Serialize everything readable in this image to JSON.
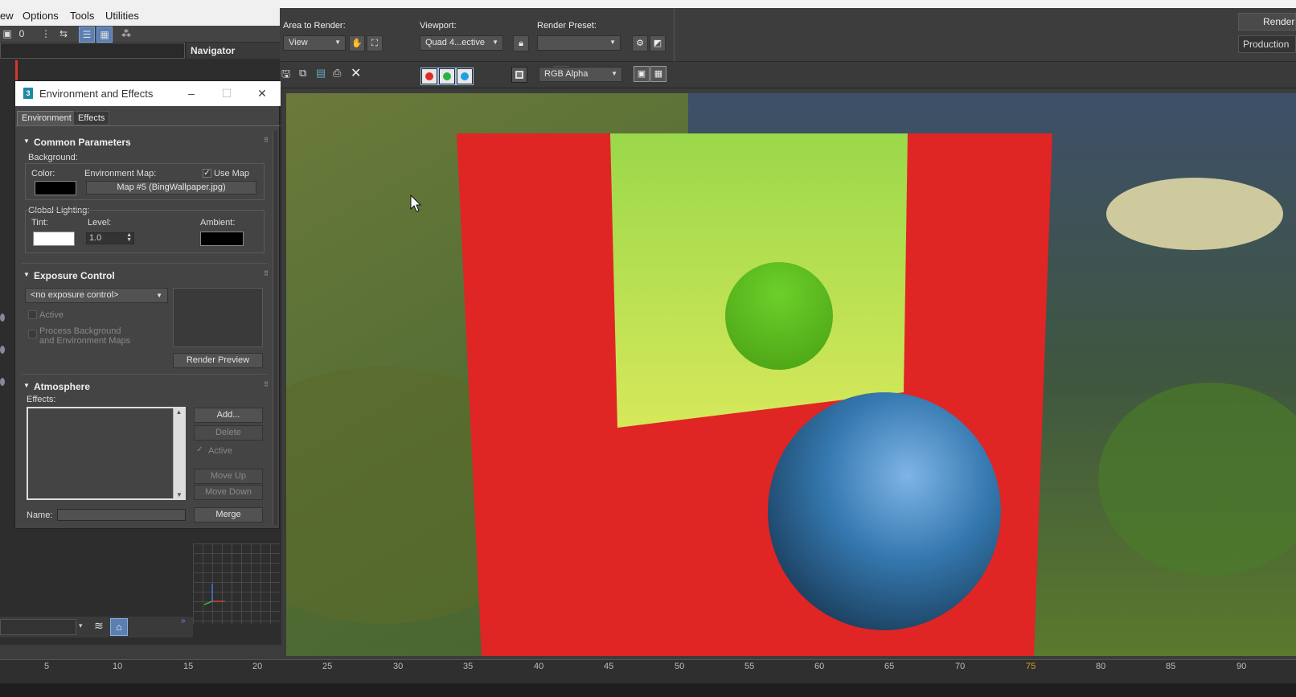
{
  "menubar": {
    "items": [
      "ew",
      "Options",
      "Tools",
      "Utilities"
    ]
  },
  "navigator": {
    "title": "Navigator"
  },
  "render_frame": {
    "area_to_render": {
      "label": "Area to Render:",
      "value": "View"
    },
    "viewport": {
      "label": "Viewport:",
      "value": "Quad 4...ective"
    },
    "render_preset": {
      "label": "Render Preset:",
      "value": ""
    },
    "render_button": "Render",
    "production": "Production",
    "channel_display": "RGB Alpha",
    "channel_buttons": [
      {
        "name": "red-channel",
        "color": "#e02a2a"
      },
      {
        "name": "green-channel",
        "color": "#2bb04a"
      },
      {
        "name": "blue-channel",
        "color": "#1ea0e0"
      }
    ]
  },
  "env_dialog": {
    "title": "Environment and Effects",
    "tabs": [
      "Environment",
      "Effects"
    ],
    "common": {
      "header": "Common Parameters",
      "background_label": "Background:",
      "color_label": "Color:",
      "env_map_label": "Environment Map:",
      "use_map_label": "Use Map",
      "use_map_checked": true,
      "map_button": "Map #5 (BingWallpaper.jpg)",
      "global_lighting_label": "Global Lighting:",
      "tint_label": "Tint:",
      "level_label": "Level:",
      "level_value": "1.0",
      "ambient_label": "Ambient:",
      "background_color": "#000000",
      "tint_color": "#ffffff",
      "ambient_color": "#000000"
    },
    "exposure": {
      "header": "Exposure Control",
      "dropdown": "<no exposure control>",
      "active_label": "Active",
      "process_line1": "Process Background",
      "process_line2": "and Environment Maps",
      "render_preview": "Render Preview"
    },
    "atmosphere": {
      "header": "Atmosphere",
      "effects_label": "Effects:",
      "add": "Add...",
      "delete": "Delete",
      "active_label": "Active",
      "move_up": "Move Up",
      "move_down": "Move Down",
      "name_label": "Name:",
      "merge": "Merge"
    }
  },
  "timeline": {
    "ticks": [
      "5",
      "10",
      "15",
      "20",
      "25",
      "30",
      "35",
      "40",
      "45",
      "50",
      "55",
      "60",
      "65",
      "70",
      "75",
      "80",
      "85",
      "90"
    ]
  },
  "scene_colors": {
    "plane": "#e02525",
    "small_sphere": "#63c81e",
    "large_sphere": "#2d6fa3"
  }
}
